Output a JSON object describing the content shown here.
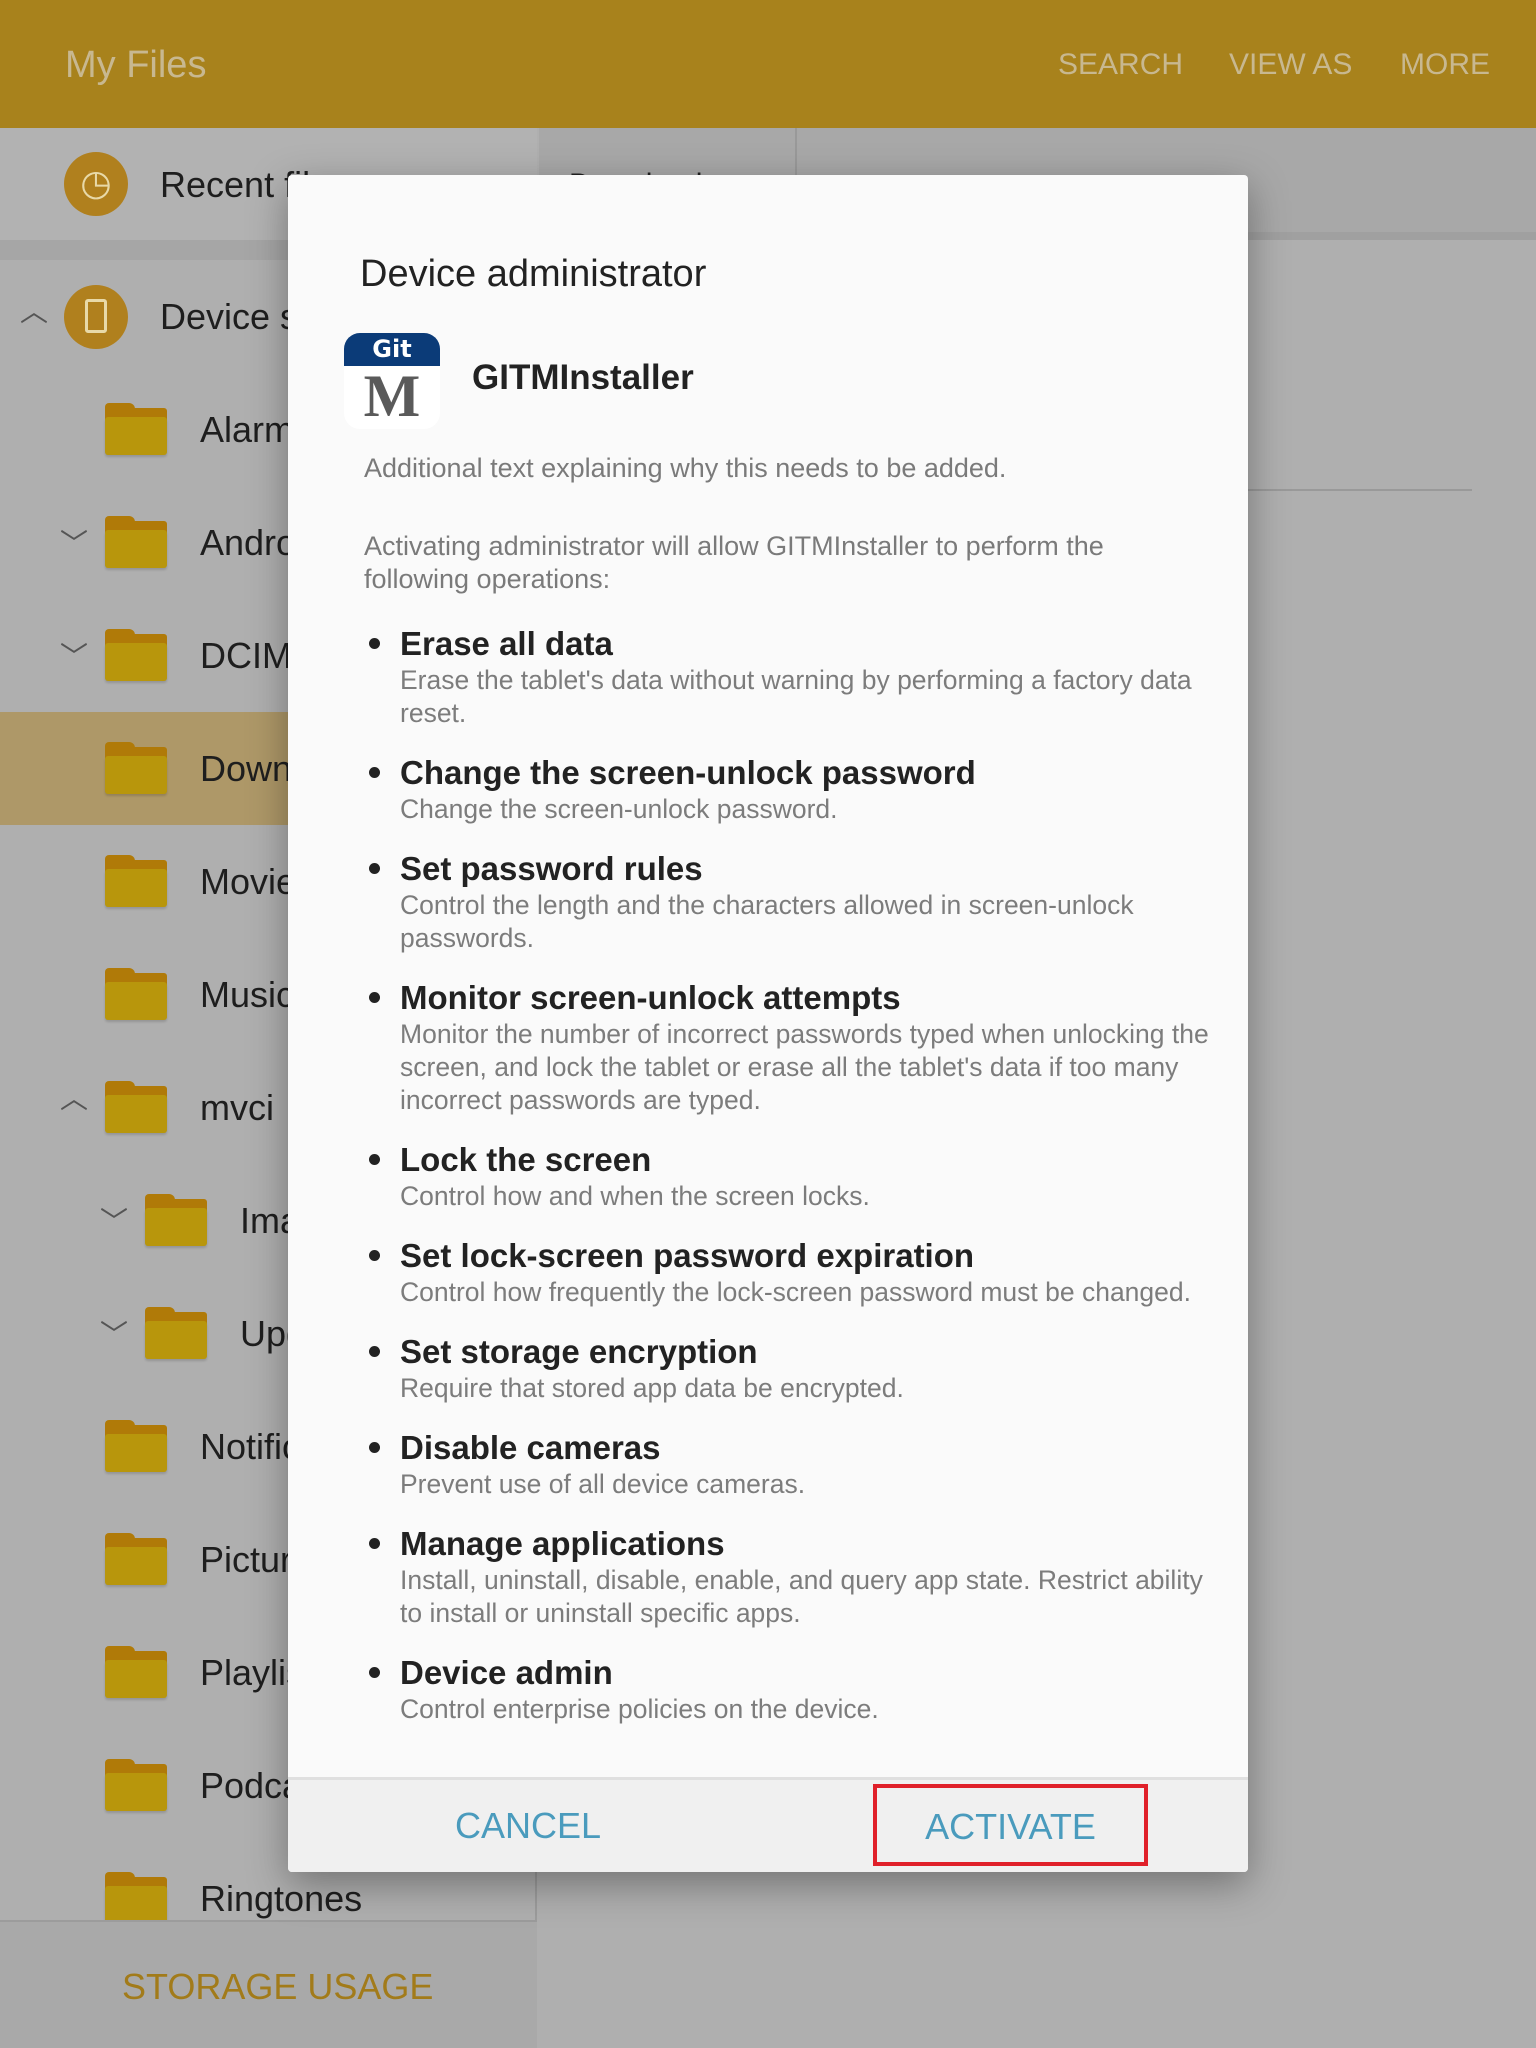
{
  "header": {
    "title": "My Files",
    "actions": [
      "SEARCH",
      "VIEW AS",
      "MORE"
    ],
    "color": "#a8821c"
  },
  "sidebar": {
    "recent": "Recent files",
    "device": "Device storage",
    "folders": [
      {
        "label": "Alarms",
        "expander": ""
      },
      {
        "label": "Android",
        "expander": "down"
      },
      {
        "label": "DCIM",
        "expander": "down"
      },
      {
        "label": "Download",
        "expander": "",
        "selected": true
      },
      {
        "label": "Movies",
        "expander": ""
      },
      {
        "label": "Music",
        "expander": ""
      },
      {
        "label": "mvci",
        "expander": "up"
      },
      {
        "label": "Images",
        "expander": "down",
        "level": 2
      },
      {
        "label": "Update",
        "expander": "down",
        "level": 2
      },
      {
        "label": "Notifications",
        "expander": ""
      },
      {
        "label": "Pictures",
        "expander": ""
      },
      {
        "label": "Playlists",
        "expander": ""
      },
      {
        "label": "Podcasts",
        "expander": ""
      },
      {
        "label": "Ringtones",
        "expander": ""
      }
    ],
    "storage_usage": "STORAGE USAGE"
  },
  "main": {
    "breadcrumb": "Download"
  },
  "dialog": {
    "title": "Device administrator",
    "app_name": "GITMInstaller",
    "app_icon_text": "Git",
    "app_icon_letter": "M",
    "additional_text": "Additional text explaining why this needs to be added.",
    "intro": "Activating administrator will allow GITMInstaller to perform the following operations:",
    "items": [
      {
        "title": "Erase all data",
        "desc": "Erase the tablet's data without warning by performing a factory data reset."
      },
      {
        "title": "Change the screen-unlock password",
        "desc": "Change the screen-unlock password."
      },
      {
        "title": "Set password rules",
        "desc": "Control the length and the characters allowed in screen-unlock passwords."
      },
      {
        "title": "Monitor screen-unlock attempts",
        "desc": "Monitor the number of incorrect passwords typed when unlocking the screen, and lock the tablet or erase all the tablet's data if too many incorrect passwords are typed."
      },
      {
        "title": "Lock the screen",
        "desc": "Control how and when the screen locks."
      },
      {
        "title": "Set lock-screen password expiration",
        "desc": "Control how frequently the lock-screen password must be changed."
      },
      {
        "title": "Set storage encryption",
        "desc": "Require that stored app data be encrypted."
      },
      {
        "title": "Disable cameras",
        "desc": "Prevent use of all device cameras."
      },
      {
        "title": "Manage applications",
        "desc": "Install, uninstall, disable, enable, and query app state. Restrict ability to install or uninstall specific apps."
      },
      {
        "title": "Device admin",
        "desc": "Control enterprise policies on the device."
      }
    ],
    "cancel": "CANCEL",
    "activate": "ACTIVATE",
    "button_color": "#4a9bbd",
    "highlight_color": "#e0202a"
  }
}
